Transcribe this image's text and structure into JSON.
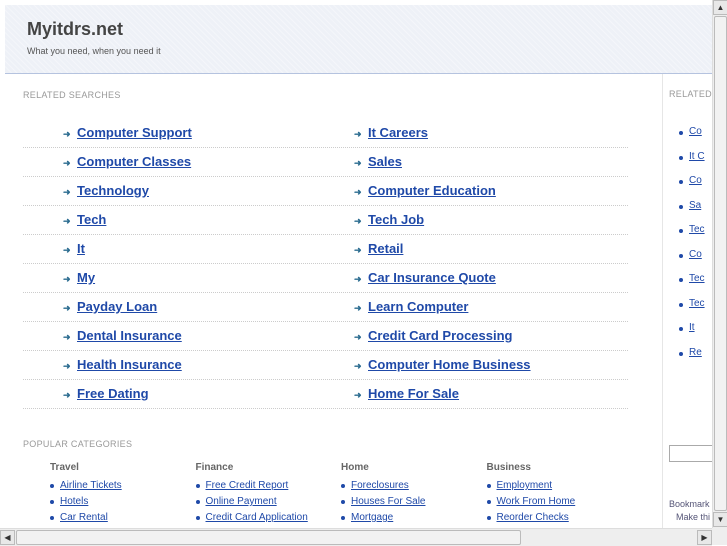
{
  "header": {
    "title": "Myitdrs.net",
    "tagline": "What you need, when you need it"
  },
  "related": {
    "label": "RELATED SEARCHES",
    "rows": [
      {
        "left": "Computer Support",
        "right": "It Careers"
      },
      {
        "left": "Computer Classes",
        "right": "Sales"
      },
      {
        "left": "Technology",
        "right": "Computer Education"
      },
      {
        "left": "Tech",
        "right": "Tech Job"
      },
      {
        "left": "It",
        "right": "Retail"
      },
      {
        "left": "My",
        "right": "Car Insurance Quote"
      },
      {
        "left": "Payday Loan",
        "right": "Learn Computer"
      },
      {
        "left": "Dental Insurance",
        "right": "Credit Card Processing"
      },
      {
        "left": "Health Insurance",
        "right": "Computer Home Business"
      },
      {
        "left": "Free Dating",
        "right": "Home For Sale"
      }
    ]
  },
  "popular": {
    "label": "POPULAR CATEGORIES",
    "columns": [
      {
        "heading": "Travel",
        "items": [
          "Airline Tickets",
          "Hotels",
          "Car Rental"
        ]
      },
      {
        "heading": "Finance",
        "items": [
          "Free Credit Report",
          "Online Payment",
          "Credit Card Application"
        ]
      },
      {
        "heading": "Home",
        "items": [
          "Foreclosures",
          "Houses For Sale",
          "Mortgage"
        ]
      },
      {
        "heading": "Business",
        "items": [
          "Employment",
          "Work From Home",
          "Reorder Checks"
        ]
      }
    ]
  },
  "sidebar": {
    "label": "RELATED",
    "items": [
      "Co",
      "It C",
      "Co",
      "Sa",
      "Tec",
      "Co",
      "Tec",
      "Tec",
      "It",
      "Re"
    ],
    "bookmark_text": "Bookmark",
    "bookmark_text2": "Make thi"
  },
  "icons": {
    "row_arrow": "right-arrow-icon",
    "scroll_up": "scroll-up-icon",
    "scroll_down": "scroll-down-icon",
    "scroll_left": "scroll-left-icon",
    "scroll_right": "scroll-right-icon"
  },
  "colors": {
    "link": "#1f49a8",
    "arrow": "#2b6c90",
    "header_bg": "#eef1f7"
  }
}
